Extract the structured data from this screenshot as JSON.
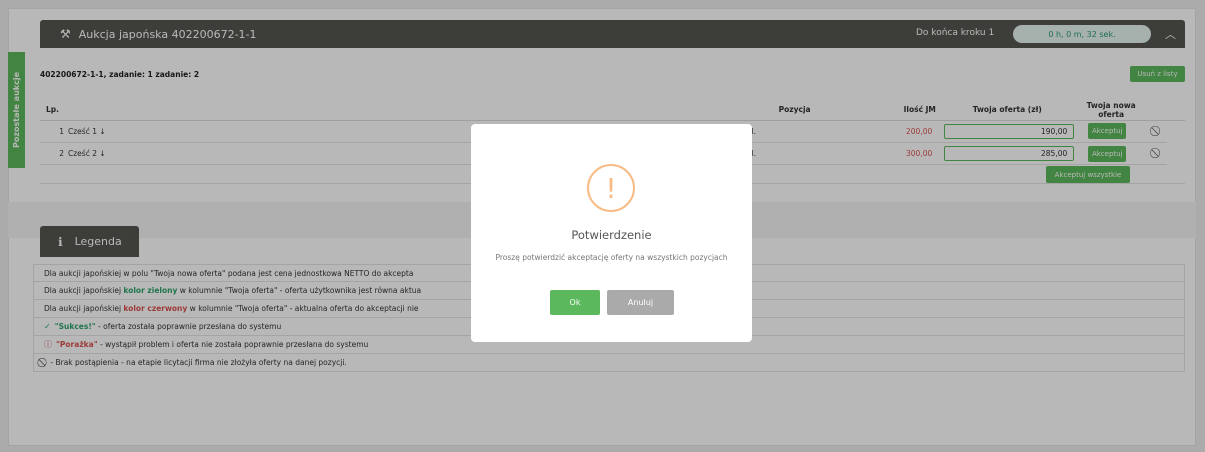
{
  "side_tab": {
    "label": "Pozostałe aukcje"
  },
  "header": {
    "title": "Aukcja japońska 402200672-1-1",
    "step_label": "Do końca kroku 1",
    "timer": "0 h, 0 m, 32 sek.",
    "hammer_icon": "hammer-icon",
    "collapse_icon": "chevron-up-icon"
  },
  "task_line": "402200672-1-1, zadanie: 1 zadanie: 2",
  "remove_button": "Usuń z listy",
  "table": {
    "headers": {
      "lp": "Lp.",
      "position": "Pozycja",
      "qty_unit": "Ilość JM",
      "your_offer": "Twoja oferta (zł)",
      "new_offer": "Twoja nowa oferta"
    },
    "rows": [
      {
        "lp": "1",
        "name": "Cześć 1 ↓",
        "unit": "npl.",
        "your_offer": "200,00",
        "new_offer": "190,00",
        "accept": "Akceptuj"
      },
      {
        "lp": "2",
        "name": "Cześć 2 ↓",
        "unit": "npl.",
        "your_offer": "300,00",
        "new_offer": "285,00",
        "accept": "Akceptuj"
      }
    ],
    "accept_all": "Akceptuj wszystkie"
  },
  "legend": {
    "title": "Legenda",
    "lines": {
      "l1": "Dla aukcji japońskiej w polu \"Twoja nowa oferta\" podana jest cena jednostkowa NETTO do akcepta",
      "l2_pre": "Dla aukcji japońskiej ",
      "l2_hl": "kolor zielony",
      "l2_post": " w kolumnie \"Twoja oferta\" - oferta użytkownika jest równa aktua",
      "l3_pre": "Dla aukcji japońskiej ",
      "l3_hl": "kolor czerwony",
      "l3_post": " w kolumnie \"Twoja oferta\" - aktualna oferta do akceptacji nie",
      "l4_hl": "\"Sukces!\"",
      "l4_post": " - oferta została poprawnie przesłana do systemu",
      "l5_hl": "\"Porażka\"",
      "l5_post": " - wystąpił problem i oferta nie została poprawnie przesłana do systemu",
      "l6": " - Brak postąpienia - na etapie licytacji firma nie złożyła oferty na danej pozycji."
    }
  },
  "modal": {
    "title": "Potwierdzenie",
    "text": "Proszę potwierdzić akceptację oferty na wszystkich pozycjach",
    "ok": "Ok",
    "cancel": "Anuluj"
  },
  "colors": {
    "header_bg": "#55574f",
    "accent_green": "#5cb85c",
    "price_red": "#d9534f",
    "warning_orange": "#f8bb86"
  }
}
